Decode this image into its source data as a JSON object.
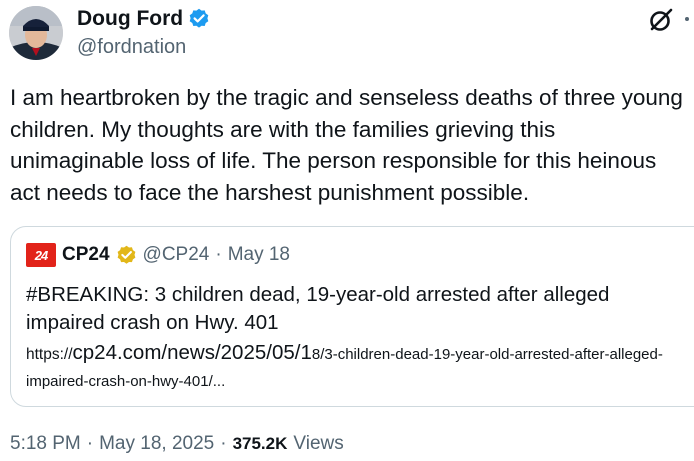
{
  "author": {
    "display_name": "Doug Ford",
    "handle": "@fordnation",
    "avatar": "person-photo"
  },
  "tweet": {
    "text": "I am heartbroken by the tragic and senseless deaths of three young children. My thoughts are with the families grieving this unimaginable loss of life. The person responsible for this heinous act needs to face the harshest punishment possible."
  },
  "quote": {
    "logo_text": "24",
    "display_name": "CP24",
    "handle": "@CP24",
    "separator": "·",
    "date": "May 18",
    "text": "#BREAKING: 3 children dead, 19-year-old arrested after alleged impaired crash on Hwy. 401",
    "link_part1": "https://",
    "link_part2": "cp24.com/news/2025/05/1",
    "link_part3": "8/3-children-dead-19-year-old-arrested-after-alleged-impaired-crash-on-hwy-401/..."
  },
  "footer": {
    "time": "5:18 PM",
    "sep1": "·",
    "date": "May 18, 2025",
    "sep2": "·",
    "views_count": "375.2K",
    "views_label": "Views"
  },
  "colors": {
    "text_primary": "#0f1419",
    "text_secondary": "#536471",
    "verified_blue": "#1d9bf0",
    "verified_gold": "#e2b719",
    "brand_red": "#e2231a",
    "border": "#cfd9de"
  },
  "icons": [
    "verified-badge-icon",
    "grok-icon",
    "more-icon",
    "verified-gold-badge-icon"
  ]
}
